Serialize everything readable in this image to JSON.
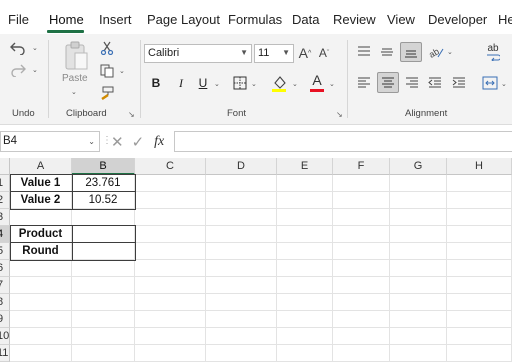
{
  "menu": {
    "tabs": [
      {
        "label": "File"
      },
      {
        "label": "Home"
      },
      {
        "label": "Insert"
      },
      {
        "label": "Page Layout"
      },
      {
        "label": "Formulas"
      },
      {
        "label": "Data"
      },
      {
        "label": "Review"
      },
      {
        "label": "View"
      },
      {
        "label": "Developer"
      },
      {
        "label": "He"
      }
    ],
    "active_tab": "Home"
  },
  "ribbon": {
    "undo_group_label": "Undo",
    "clipboard": {
      "group_label": "Clipboard",
      "paste_label": "Paste"
    },
    "font": {
      "group_label": "Font",
      "font_name": "Calibri",
      "font_size": "11",
      "bold_label": "B",
      "italic_label": "I",
      "underline_label": "U",
      "grow_label": "A^",
      "shrink_label": "Aˇ",
      "font_color_label": "A",
      "highlight_color": "#ffff00",
      "font_color": "#e81123"
    },
    "alignment": {
      "group_label": "Alignment",
      "wrap_label": "ab"
    }
  },
  "formula_bar": {
    "name_box": "B4",
    "fx_label": "fx",
    "formula": ""
  },
  "sheet": {
    "columns": [
      "A",
      "B",
      "C",
      "D",
      "E",
      "F",
      "G",
      "H"
    ],
    "rows": [
      "1",
      "2",
      "3",
      "4",
      "5",
      "6",
      "7",
      "8",
      "9",
      "10",
      "11"
    ],
    "cells": {
      "A1": "Value 1",
      "B1": "23.761",
      "A2": "Value 2",
      "B2": "10.52",
      "A4": "Product",
      "B4": "",
      "A5": "Round",
      "B5": ""
    }
  },
  "colors": {
    "accent": "#1e7145"
  }
}
